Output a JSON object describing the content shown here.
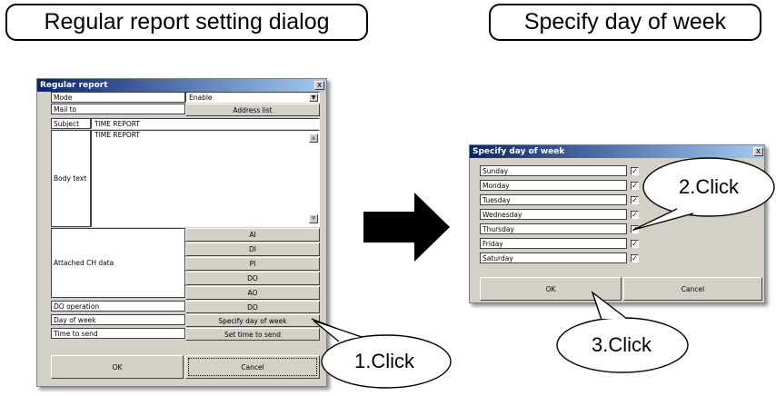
{
  "headings": {
    "left": "Regular report setting dialog",
    "right": "Specify day of week"
  },
  "regular_report": {
    "title": "Regular report",
    "close": "x",
    "mode_label": "Mode",
    "mode_value": "Enable",
    "mail_to_label": "Mail to",
    "address_list_button": "Address list",
    "subject_label": "Subject",
    "subject_value": "TIME REPORT",
    "body_label": "Body text",
    "body_value": "TIME REPORT",
    "attached_label": "Attached CH data",
    "attached_buttons": [
      "AI",
      "DI",
      "PI",
      "DO",
      "AO"
    ],
    "do_operation_label": "DO operation",
    "do_operation_button": "DO",
    "day_of_week_label": "Day of week",
    "day_of_week_button": "Specify day of week",
    "time_to_send_label": "Time to send",
    "time_to_send_button": "Set time to send",
    "ok_button": "OK",
    "cancel_button": "Cancel"
  },
  "specify_day": {
    "title": "Specify day of week",
    "close": "x",
    "days": [
      {
        "label": "Sunday",
        "checked": true
      },
      {
        "label": "Monday",
        "checked": true
      },
      {
        "label": "Tuesday",
        "checked": true
      },
      {
        "label": "Wednesday",
        "checked": true
      },
      {
        "label": "Thursday",
        "checked": true
      },
      {
        "label": "Friday",
        "checked": true
      },
      {
        "label": "Saturday",
        "checked": true
      }
    ],
    "ok_button": "OK",
    "cancel_button": "Cancel"
  },
  "callouts": {
    "one": "1.Click",
    "two": "2.Click",
    "three": "3.Click"
  }
}
